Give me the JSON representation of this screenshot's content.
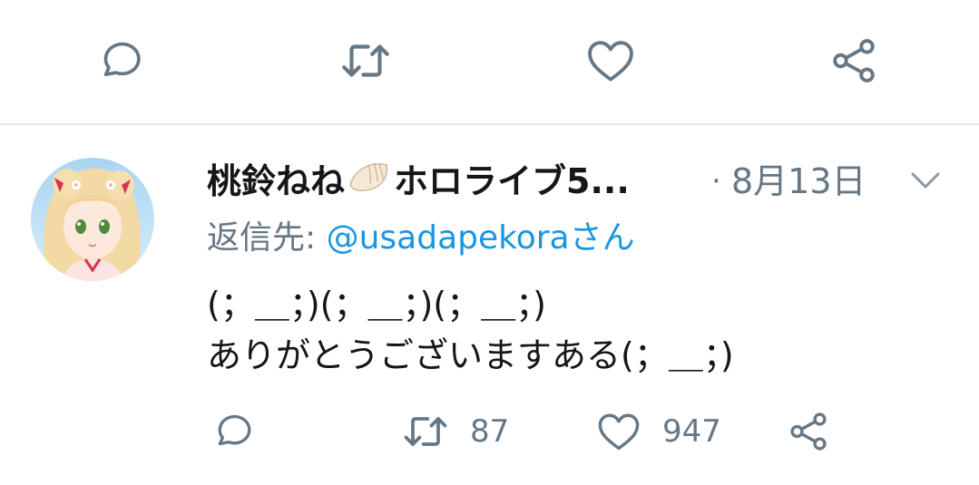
{
  "tweet": {
    "author_name": "桃鈴ねね",
    "author_name_suffix": "ホロライブ5...",
    "separator": "·",
    "date": "8月13日",
    "reply_prefix": "返信先: ",
    "reply_handle": "@usadapekora",
    "reply_suffix": "さん",
    "body_line1": "(；＿；)(；＿；)(；＿；)",
    "body_line2": "ありがとうございますある(；＿；)",
    "retweet_count": "87",
    "like_count": "947"
  },
  "icons": {
    "top": [
      "reply-icon",
      "retweet-icon",
      "like-icon",
      "share-icon"
    ],
    "bottom": [
      "reply-icon",
      "retweet-icon",
      "like-icon",
      "share-icon"
    ],
    "name_emoji": "dumpling-icon",
    "menu": "chevron-down-icon"
  },
  "colors": {
    "icon_gray": "#657786",
    "link_blue": "#1b95e0",
    "divider": "#e1e8ed",
    "text": "#14171a"
  }
}
